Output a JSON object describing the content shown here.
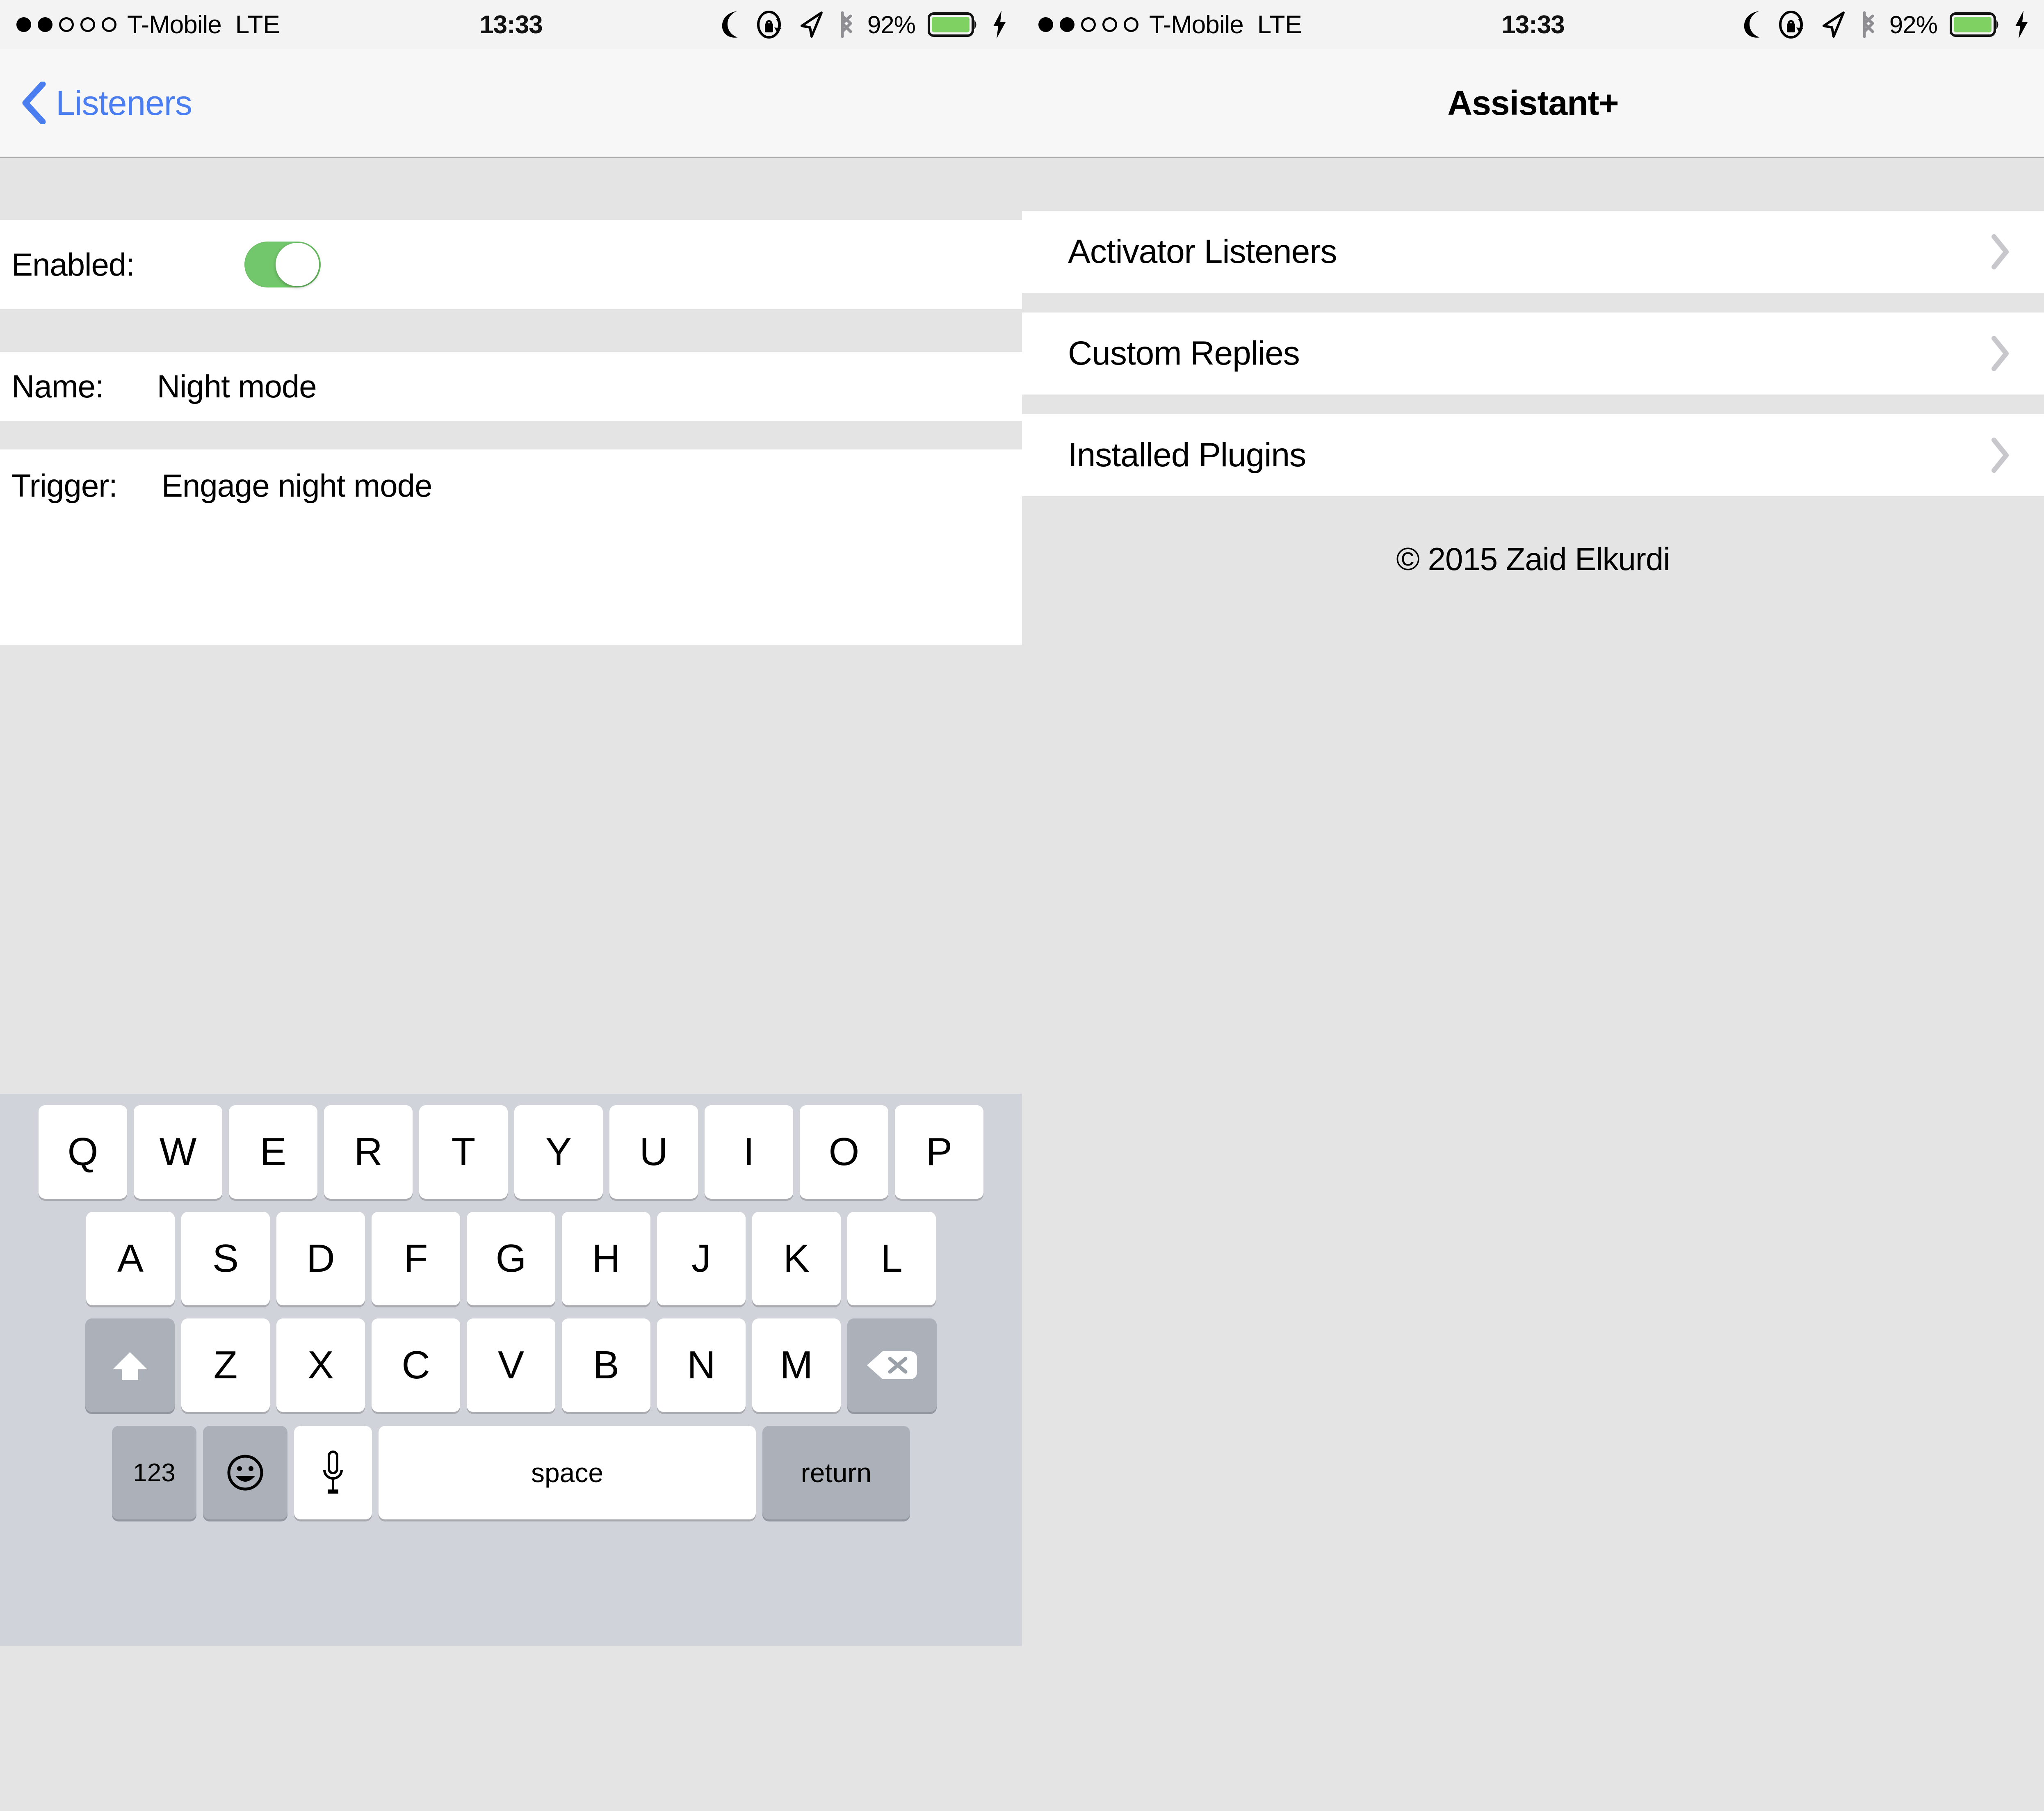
{
  "status_bar": {
    "signal_dots_total": 5,
    "signal_dots_filled": 2,
    "carrier": "T-Mobile",
    "network": "LTE",
    "time": "13:33",
    "battery_percent": "92%",
    "icons": [
      "moon-icon",
      "rotation-lock-icon",
      "location-arrow-icon",
      "bluetooth-icon",
      "battery-icon",
      "charging-bolt-icon"
    ],
    "battery_color": "#7FD262"
  },
  "left_panel": {
    "nav": {
      "back_label": "Listeners",
      "tint_color": "#4A7DF0"
    },
    "rows": {
      "enabled_label": "Enabled:",
      "enabled_state": "on",
      "toggle_on_color": "#72C66B",
      "name_label": "Name:",
      "name_value": "Night mode",
      "trigger_label": "Trigger:",
      "trigger_value": "Engage night mode"
    },
    "keyboard": {
      "row1": [
        "Q",
        "W",
        "E",
        "R",
        "T",
        "Y",
        "U",
        "I",
        "O",
        "P"
      ],
      "row2": [
        "A",
        "S",
        "D",
        "F",
        "G",
        "H",
        "J",
        "K",
        "L"
      ],
      "row3": [
        "Z",
        "X",
        "C",
        "V",
        "B",
        "N",
        "M"
      ],
      "shift_key": "shift-key",
      "backspace_key": "backspace-key",
      "numbers_key": "123",
      "emoji_key": "emoji-key",
      "dictation_key": "microphone-key",
      "space_key": "space",
      "return_key": "return",
      "background_color": "#D0D3D9",
      "key_color": "#FFFFFF",
      "modifier_key_color": "#ABB0B9"
    }
  },
  "right_panel": {
    "nav": {
      "title": "Assistant+"
    },
    "list_items": [
      {
        "label": "Activator Listeners",
        "accessory": "chevron-right-icon"
      },
      {
        "label": "Custom Replies",
        "accessory": "chevron-right-icon"
      },
      {
        "label": "Installed Plugins",
        "accessory": "chevron-right-icon"
      }
    ],
    "footer": {
      "copyright": "© 2015 Zaid Elkurdi"
    }
  }
}
